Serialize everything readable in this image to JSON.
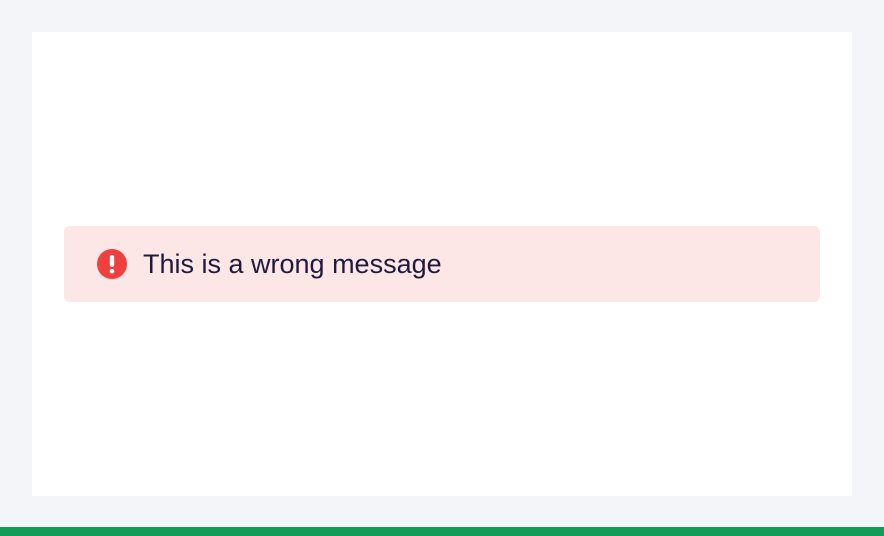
{
  "alert": {
    "type": "error",
    "icon": "exclamation-circle-icon",
    "message": "This is a wrong message"
  },
  "colors": {
    "page_background": "#f4f5f9",
    "card_background": "#ffffff",
    "alert_background": "#fce6e6",
    "alert_icon": "#ef4040",
    "alert_text": "#1f1a3d",
    "bottom_bar": "#0f9d58"
  }
}
